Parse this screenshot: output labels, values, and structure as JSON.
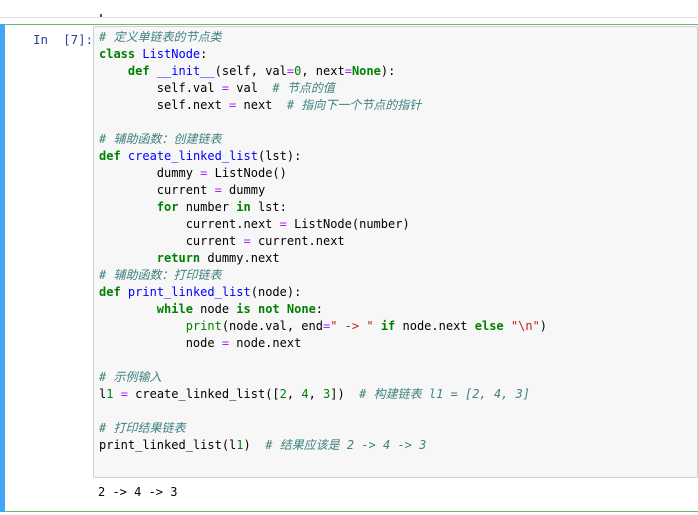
{
  "cell": {
    "prompt": "In  [7]:",
    "code_lines": [
      "# 定义单链表的节点类",
      "class ListNode:",
      "    def __init__(self, val=0, next=None):",
      "        self.val = val  # 节点的值",
      "        self.next = next  # 指向下一个节点的指针",
      "",
      "# 辅助函数：创建链表",
      "def create_linked_list(lst):",
      "        dummy = ListNode()",
      "        current = dummy",
      "        for number in lst:",
      "            current.next = ListNode(number)",
      "            current = current.next",
      "        return dummy.next",
      "# 辅助函数：打印链表",
      "def print_linked_list(node):",
      "        while node is not None:",
      "            print(node.val, end=\" -> \" if node.next else \"\\n\")",
      "            node = node.next",
      "",
      "# 示例输入",
      "l1 = create_linked_list([2, 4, 3])  # 构建链表 l1 = [2, 4, 3]",
      "",
      "# 打印结果链表",
      "print_linked_list(l1)  # 结果应该是 2 -> 4 -> 3"
    ],
    "output": "2 -> 4 -> 3"
  }
}
